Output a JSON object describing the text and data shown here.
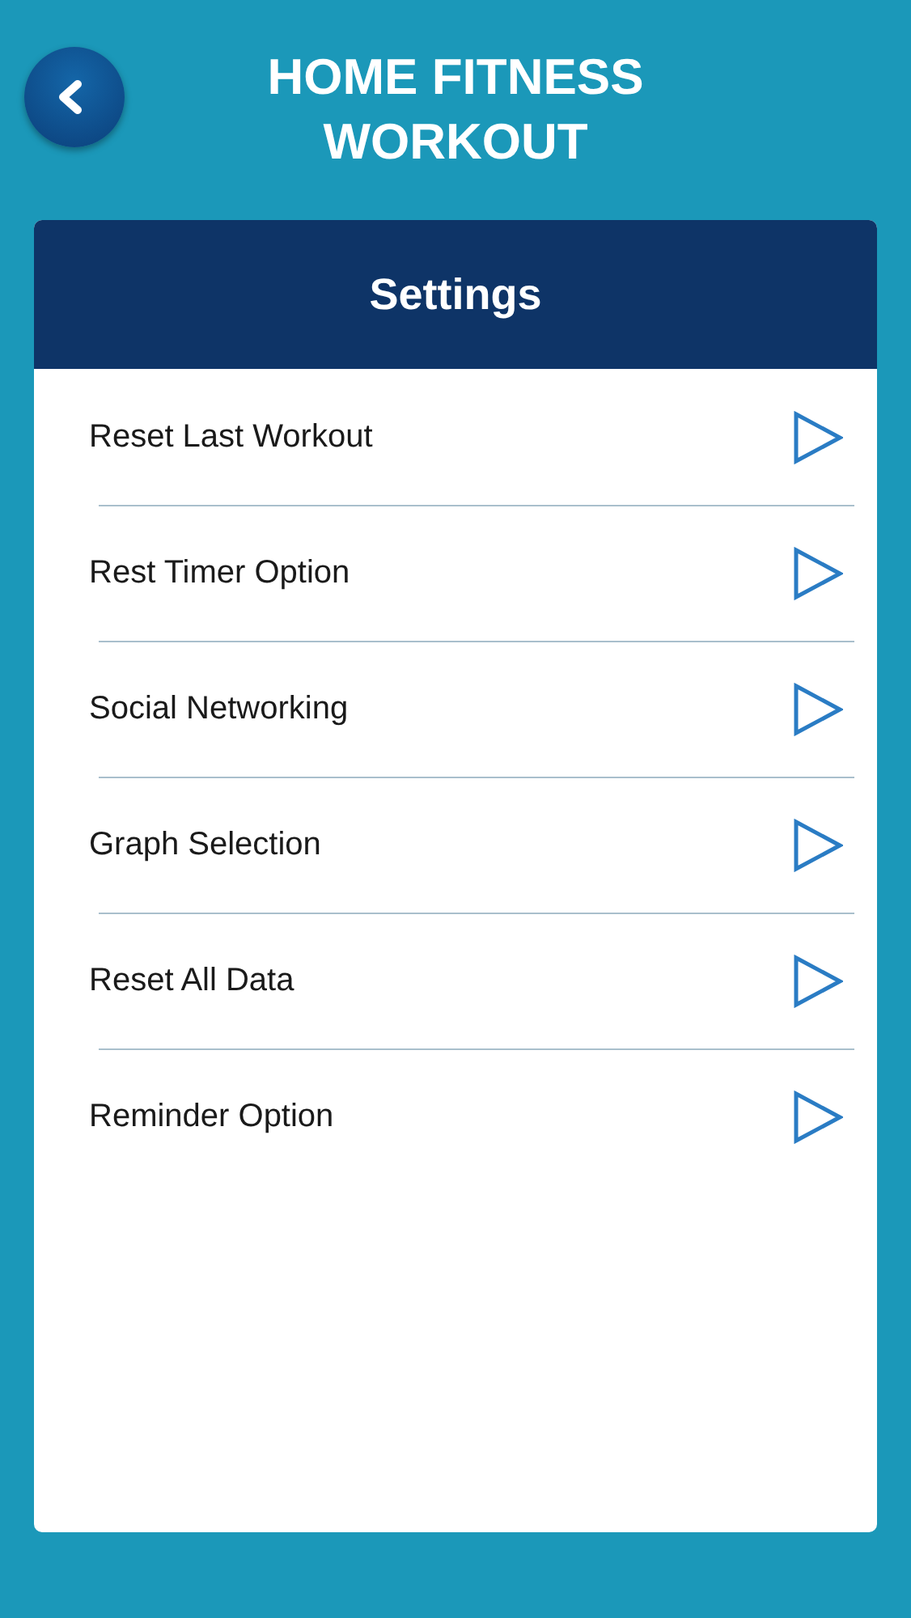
{
  "header": {
    "title": "HOME FITNESS WORKOUT"
  },
  "panel": {
    "title": "Settings",
    "items": [
      {
        "label": "Reset Last Workout"
      },
      {
        "label": "Rest Timer Option"
      },
      {
        "label": "Social Networking"
      },
      {
        "label": "Graph Selection"
      },
      {
        "label": "Reset All Data"
      },
      {
        "label": "Reminder Option"
      }
    ]
  }
}
